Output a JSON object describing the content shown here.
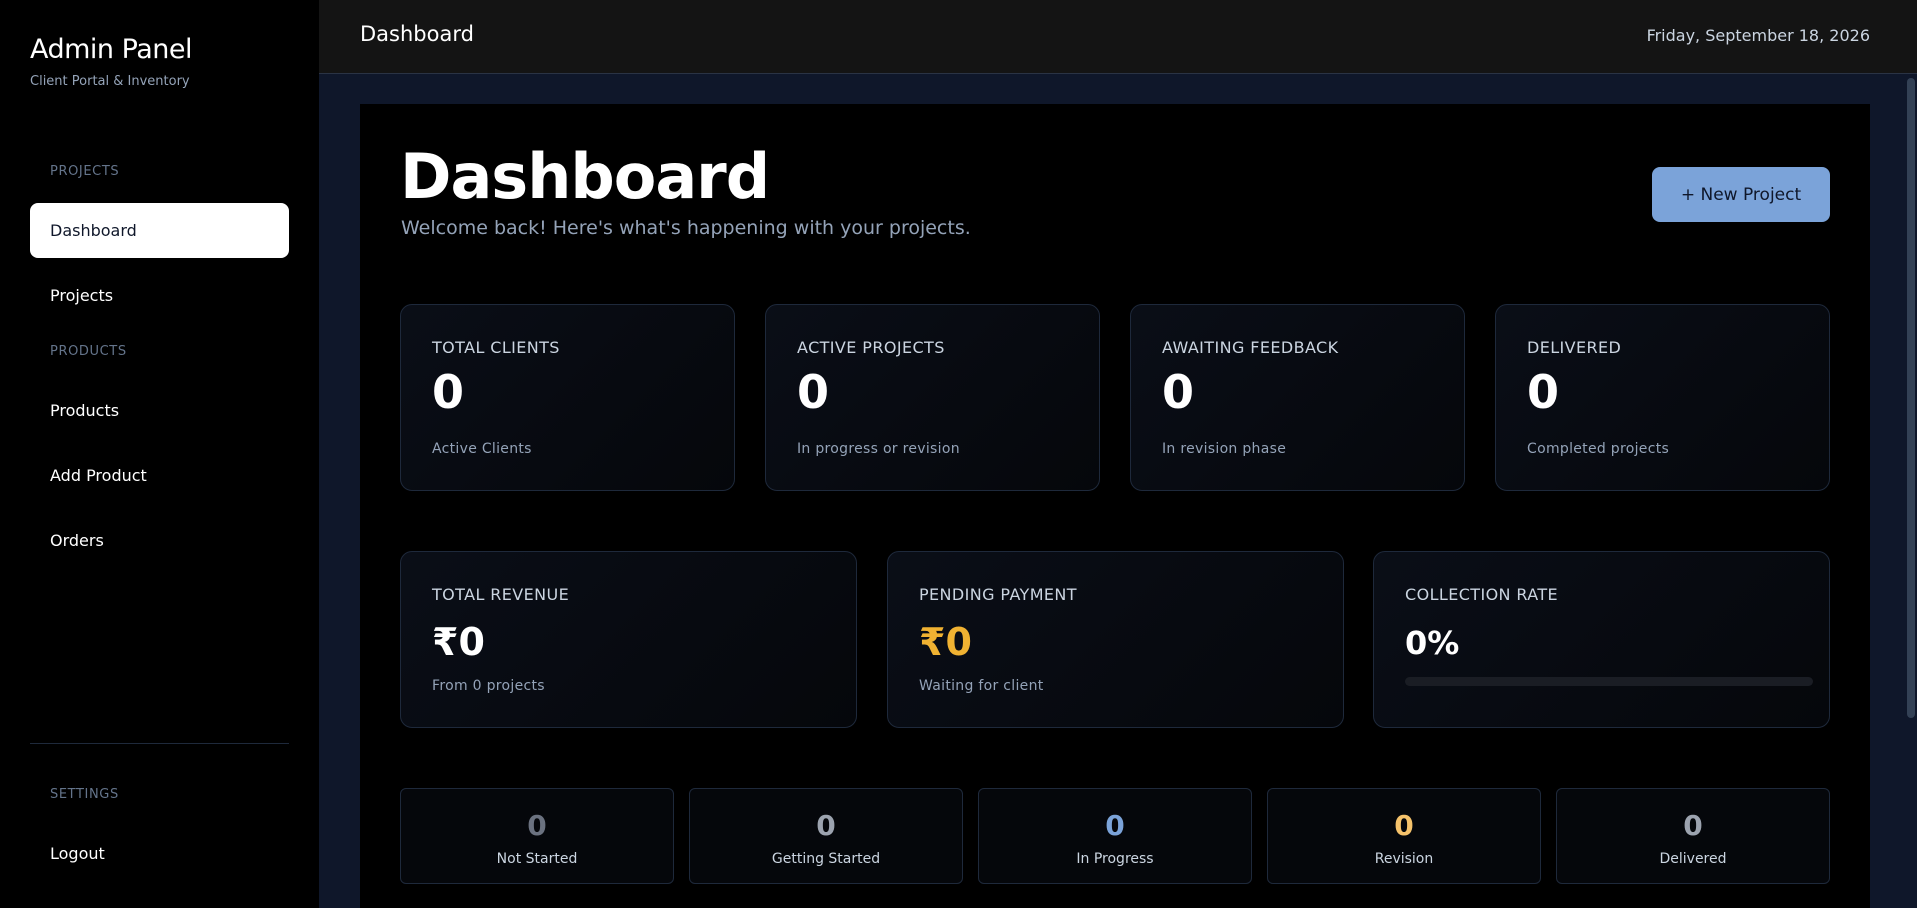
{
  "sidebar": {
    "brand_title": "Admin Panel",
    "brand_subtitle": "Client Portal & Inventory",
    "sections": {
      "projects": "PROJECTS",
      "products": "PRODUCTS",
      "settings": "SETTINGS"
    },
    "items": [
      {
        "label": "Dashboard",
        "active": true
      },
      {
        "label": "Projects"
      },
      {
        "label": "Products"
      },
      {
        "label": "Add Product"
      },
      {
        "label": "Orders"
      },
      {
        "label": "Logout"
      }
    ]
  },
  "topbar": {
    "title": "Dashboard",
    "date": "Friday, September 18, 2026"
  },
  "main": {
    "title": "Dashboard",
    "subtitle": "Welcome back! Here's what's happening with your projects.",
    "new_project_label": "+ New Project",
    "stats": [
      {
        "label": "TOTAL CLIENTS",
        "value": "0",
        "sub": "Active Clients"
      },
      {
        "label": "ACTIVE PROJECTS",
        "value": "0",
        "sub": "In progress or revision"
      },
      {
        "label": "AWAITING FEEDBACK",
        "value": "0",
        "sub": "In revision phase"
      },
      {
        "label": "DELIVERED",
        "value": "0",
        "sub": "Completed projects"
      }
    ],
    "finance": {
      "revenue": {
        "label": "TOTAL REVENUE",
        "value": "₹0",
        "sub": "From 0 projects"
      },
      "pending": {
        "label": "PENDING PAYMENT",
        "value": "₹0",
        "sub": "Waiting for client"
      },
      "collection": {
        "label": "COLLECTION RATE",
        "value": "0%",
        "progress": 0
      }
    },
    "statuses": [
      {
        "value": "0",
        "label": "Not Started",
        "color": "#6b7280"
      },
      {
        "value": "0",
        "label": "Getting Started",
        "color": "#9ca3af"
      },
      {
        "value": "0",
        "label": "In Progress",
        "color": "#7ba3d9"
      },
      {
        "value": "0",
        "label": "Revision",
        "color": "#f5c26b"
      },
      {
        "value": "0",
        "label": "Delivered",
        "color": "#9ca3af"
      }
    ]
  },
  "colors": {
    "accent": "#7ba3d9",
    "pending": "#f0b232"
  }
}
